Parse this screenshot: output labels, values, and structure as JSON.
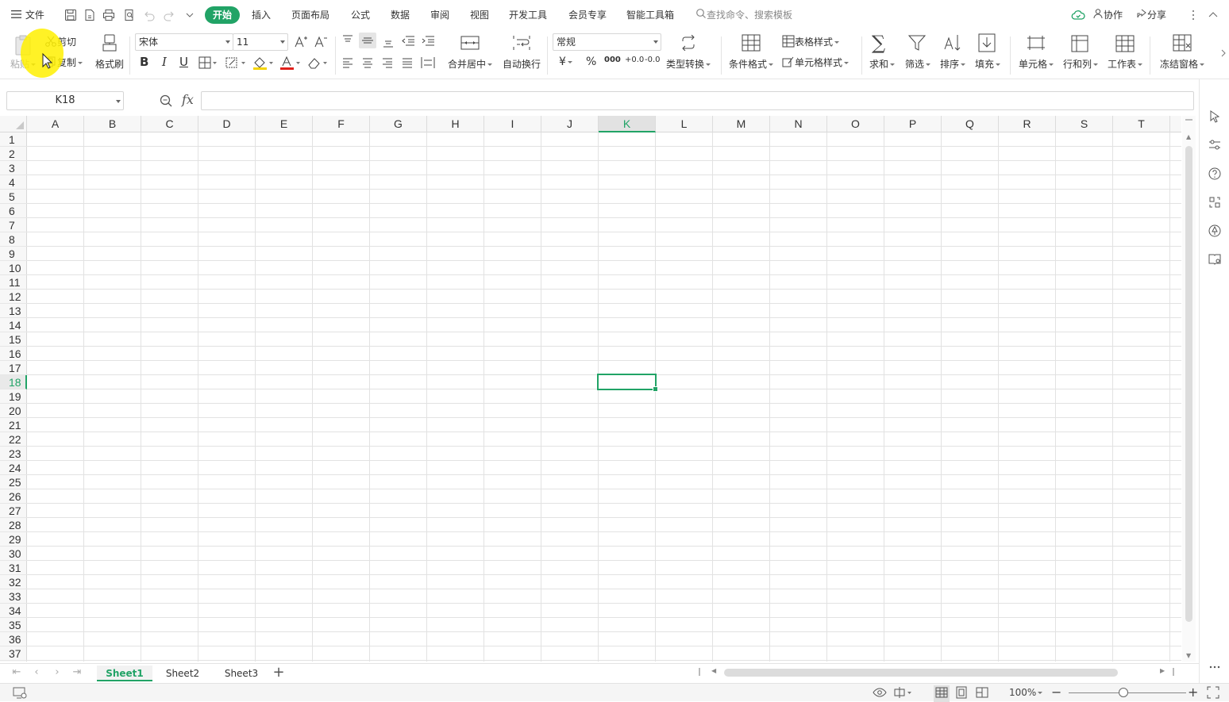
{
  "menubar": {
    "file_label": "文件",
    "tabs": [
      "开始",
      "插入",
      "页面布局",
      "公式",
      "数据",
      "审阅",
      "视图",
      "开发工具",
      "会员专享",
      "智能工具箱"
    ],
    "search_placeholder": "查找命令、搜索模板",
    "collab_label": "协作",
    "share_label": "分享"
  },
  "ribbon": {
    "paste": "粘贴",
    "cut": "剪切",
    "copy": "复制",
    "format_painter": "格式刷",
    "font_name": "宋体",
    "font_size": "11",
    "bold": "B",
    "italic": "I",
    "underline": "U",
    "merge_center": "合并居中",
    "wrap_text": "自动换行",
    "number_format": "常规",
    "currency": "¥",
    "percent": "%",
    "thousands": "000",
    "inc_decimal": "+0.0",
    "dec_decimal": "-0.0",
    "type_convert": "类型转换",
    "conditional_format": "条件格式",
    "table_style": "表格样式",
    "cell_style": "单元格样式",
    "sum": "求和",
    "filter": "筛选",
    "sort": "排序",
    "fill": "填充",
    "cell": "单元格",
    "row_col": "行和列",
    "worksheet": "工作表",
    "freeze": "冻结窗格"
  },
  "formulabar": {
    "name_box": "K18",
    "fx_label": "fx",
    "formula_value": ""
  },
  "grid": {
    "columns": [
      "A",
      "B",
      "C",
      "D",
      "E",
      "F",
      "G",
      "H",
      "I",
      "J",
      "K",
      "L",
      "M",
      "N",
      "O",
      "P",
      "Q",
      "R",
      "S",
      "T"
    ],
    "rows": [
      "1",
      "2",
      "3",
      "4",
      "5",
      "6",
      "7",
      "8",
      "9",
      "10",
      "11",
      "12",
      "13",
      "14",
      "15",
      "16",
      "17",
      "18",
      "19",
      "20",
      "21",
      "22",
      "23",
      "24",
      "25",
      "26",
      "27",
      "28",
      "29",
      "30",
      "31",
      "32",
      "33",
      "34",
      "35",
      "36",
      "37"
    ],
    "active_column": "K",
    "active_row": "18"
  },
  "sheets": {
    "tabs": [
      "Sheet1",
      "Sheet2",
      "Sheet3"
    ],
    "active": "Sheet1",
    "add_label": "+"
  },
  "statusbar": {
    "zoom": "100%"
  },
  "colors": {
    "accent": "#21a366"
  }
}
